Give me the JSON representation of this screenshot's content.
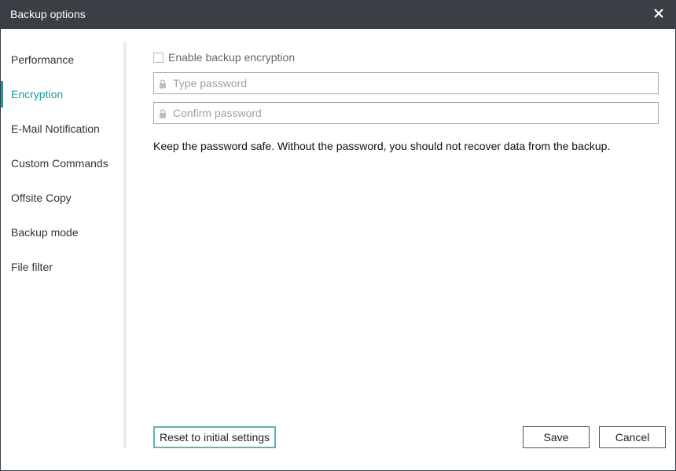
{
  "window": {
    "title": "Backup options",
    "close_icon": "close-icon",
    "titlebar_color": "#3b3f45"
  },
  "sidebar": {
    "accent_color": "#1e9a9a",
    "items": [
      {
        "label": "Performance",
        "active": false
      },
      {
        "label": "Encryption",
        "active": true
      },
      {
        "label": "E-Mail Notification",
        "active": false
      },
      {
        "label": "Custom Commands",
        "active": false
      },
      {
        "label": "Offsite Copy",
        "active": false
      },
      {
        "label": "Backup mode",
        "active": false
      },
      {
        "label": "File filter",
        "active": false
      }
    ]
  },
  "encryption": {
    "enable_label": "Enable backup encryption",
    "enable_checked": false,
    "password": {
      "placeholder": "Type password",
      "value": "",
      "icon": "lock-icon"
    },
    "confirm": {
      "placeholder": "Confirm password",
      "value": "",
      "icon": "lock-icon"
    },
    "note": "Keep the password safe. Without the password, you should not recover data from the backup."
  },
  "footer": {
    "reset_label": "Reset to initial settings",
    "save_label": "Save",
    "cancel_label": "Cancel"
  }
}
